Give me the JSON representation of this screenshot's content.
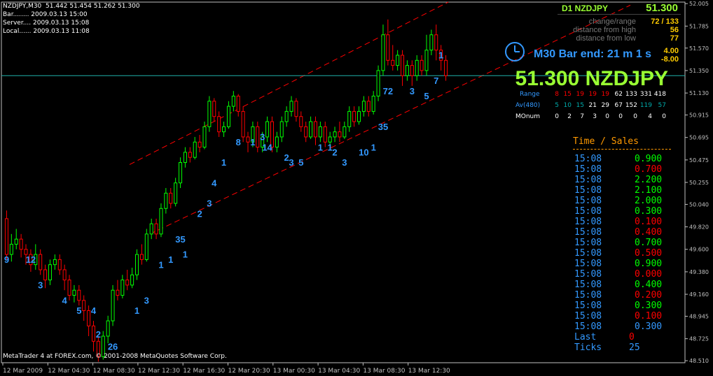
{
  "header": {
    "symbol_line": "NZDJPY,M30  51.442 51.454 51.262 51.300",
    "bar_line": "Bar........ 2009.03.13 15:00",
    "server_line": "Server.... 2009.03.13 15:08",
    "local_line": "Local...... 2009.03.13 11:08"
  },
  "panel": {
    "d1_label": "D1  NZDJPY",
    "d1_price": "51.300",
    "change_range_label": "change/range",
    "change_range_value": "72 / 133",
    "dist_high_label": "distance from high",
    "dist_high_value": "56",
    "dist_low_label": "distance from low",
    "dist_low_value": "77",
    "bar_end_text": "M30 Bar end: 21 m 1 s",
    "bar_end_val1": "4.00",
    "bar_end_val2": "-8.00",
    "big_price": "51.300 NZDJPY",
    "range_label": "Range",
    "range_values": [
      "8",
      "15",
      "19",
      "19",
      "19",
      "62",
      "133",
      "331",
      "418"
    ],
    "av_label": "Av(480)",
    "av_values": [
      "5",
      "10",
      "15",
      "21",
      "29",
      "67",
      "152",
      "119",
      "57"
    ],
    "monum_label": "MOnum",
    "monum_values": [
      "0",
      "2",
      "7",
      "3",
      "0",
      "0",
      "0",
      "4",
      "0"
    ],
    "ts_title": "Time / Sales",
    "ts_rows": [
      {
        "time": "15:08",
        "value": "0.900",
        "color": "#00ff00"
      },
      {
        "time": "15:08",
        "value": "0.700",
        "color": "#ff0000"
      },
      {
        "time": "15:08",
        "value": "2.200",
        "color": "#00ff00"
      },
      {
        "time": "15:08",
        "value": "2.100",
        "color": "#00ff00"
      },
      {
        "time": "15:08",
        "value": "2.000",
        "color": "#00ff00"
      },
      {
        "time": "15:08",
        "value": "0.300",
        "color": "#00ff00"
      },
      {
        "time": "15:08",
        "value": "0.100",
        "color": "#ff0000"
      },
      {
        "time": "15:08",
        "value": "0.400",
        "color": "#ff0000"
      },
      {
        "time": "15:08",
        "value": "0.700",
        "color": "#00ff00"
      },
      {
        "time": "15:08",
        "value": "0.500",
        "color": "#ff0000"
      },
      {
        "time": "15:08",
        "value": "0.900",
        "color": "#00ff00"
      },
      {
        "time": "15:08",
        "value": "0.000",
        "color": "#ff0000"
      },
      {
        "time": "15:08",
        "value": "0.400",
        "color": "#00ff00"
      },
      {
        "time": "15:08",
        "value": "0.200",
        "color": "#ff0000"
      },
      {
        "time": "15:08",
        "value": "0.300",
        "color": "#00ff00"
      },
      {
        "time": "15:08",
        "value": "0.100",
        "color": "#ff0000"
      },
      {
        "time": "15:08",
        "value": "0.300",
        "color": "#3399ff"
      }
    ],
    "last_label": "Last",
    "last_value": "0",
    "ticks_label": "Ticks",
    "ticks_value": "25"
  },
  "copyright": "MetaTrader 4 at FOREX.com, © 2001-2008 MetaQuotes Software Corp.",
  "colors": {
    "bull": "#00ff00",
    "bear": "#ff0000",
    "channel": "#ff0000",
    "price_line": "#20b2aa",
    "counts": "#3399ff",
    "yellow_green": "#99ff33"
  },
  "chart_data": {
    "type": "candlestick",
    "symbol": "NZDJPY",
    "timeframe": "M30",
    "ylim": [
      48.49,
      52.02
    ],
    "y_ticks": [
      "52.005",
      "51.785",
      "51.570",
      "51.350",
      "51.130",
      "50.915",
      "50.695",
      "50.475",
      "50.255",
      "50.040",
      "49.820",
      "49.600",
      "49.380",
      "49.160",
      "48.945",
      "48.725",
      "48.510"
    ],
    "x_ticks": [
      "12 Mar 2009",
      "12 Mar 04:30",
      "12 Mar 08:30",
      "12 Mar 12:30",
      "12 Mar 16:30",
      "12 Mar 20:30",
      "13 Mar 00:30",
      "13 Mar 04:30",
      "13 Mar 08:30",
      "13 Mar 12:30"
    ],
    "current_price": 51.3,
    "candles": [
      [
        49.9,
        49.55,
        49.98,
        49.5
      ],
      [
        49.55,
        49.65,
        49.75,
        49.48
      ],
      [
        49.65,
        49.7,
        49.8,
        49.6
      ],
      [
        49.7,
        49.6,
        49.75,
        49.52
      ],
      [
        49.6,
        49.55,
        49.65,
        49.45
      ],
      [
        49.55,
        49.45,
        49.6,
        49.38
      ],
      [
        49.45,
        49.55,
        49.65,
        49.4
      ],
      [
        49.55,
        49.4,
        49.6,
        49.35
      ],
      [
        49.4,
        49.3,
        49.45,
        49.22
      ],
      [
        49.3,
        49.45,
        49.5,
        49.25
      ],
      [
        49.45,
        49.5,
        49.55,
        49.4
      ],
      [
        49.5,
        49.4,
        49.55,
        49.35
      ],
      [
        49.4,
        49.3,
        49.45,
        49.2
      ],
      [
        49.3,
        49.15,
        49.35,
        49.1
      ],
      [
        49.15,
        49.2,
        49.25,
        49.08
      ],
      [
        49.2,
        49.1,
        49.25,
        49.05
      ],
      [
        49.1,
        49.0,
        49.15,
        48.9
      ],
      [
        49.0,
        48.85,
        49.05,
        48.75
      ],
      [
        48.85,
        48.7,
        48.9,
        48.6
      ],
      [
        48.7,
        48.55,
        48.75,
        48.5
      ],
      [
        48.55,
        48.75,
        48.8,
        48.52
      ],
      [
        48.75,
        48.9,
        48.95,
        48.68
      ],
      [
        48.9,
        49.2,
        49.25,
        48.85
      ],
      [
        49.2,
        49.15,
        49.3,
        49.1
      ],
      [
        49.15,
        49.3,
        49.35,
        49.12
      ],
      [
        49.3,
        49.25,
        49.4,
        49.2
      ],
      [
        49.25,
        49.35,
        49.42,
        49.22
      ],
      [
        49.35,
        49.55,
        49.6,
        49.3
      ],
      [
        49.55,
        49.5,
        49.65,
        49.45
      ],
      [
        49.5,
        49.75,
        49.8,
        49.48
      ],
      [
        49.75,
        49.85,
        49.9,
        49.7
      ],
      [
        49.85,
        49.75,
        49.9,
        49.7
      ],
      [
        49.75,
        50.0,
        50.05,
        49.72
      ],
      [
        50.0,
        50.15,
        50.2,
        49.95
      ],
      [
        50.15,
        50.05,
        50.2,
        50.0
      ],
      [
        50.05,
        50.25,
        50.3,
        50.02
      ],
      [
        50.25,
        50.45,
        50.5,
        50.2
      ],
      [
        50.45,
        50.55,
        50.6,
        50.4
      ],
      [
        50.55,
        50.5,
        50.6,
        50.45
      ],
      [
        50.5,
        50.65,
        50.7,
        50.48
      ],
      [
        50.65,
        50.6,
        50.72,
        50.55
      ],
      [
        50.6,
        50.8,
        50.85,
        50.58
      ],
      [
        50.8,
        51.05,
        51.1,
        50.75
      ],
      [
        51.05,
        50.9,
        51.08,
        50.85
      ],
      [
        50.9,
        50.75,
        50.95,
        50.7
      ],
      [
        50.75,
        50.8,
        50.85,
        50.7
      ],
      [
        50.8,
        51.0,
        51.05,
        50.78
      ],
      [
        51.0,
        51.1,
        51.15,
        50.95
      ],
      [
        51.1,
        50.95,
        51.12,
        50.9
      ],
      [
        50.95,
        50.7,
        51.0,
        50.65
      ],
      [
        50.7,
        50.65,
        50.75,
        50.55
      ],
      [
        50.65,
        50.8,
        50.85,
        50.6
      ],
      [
        50.8,
        50.6,
        50.85,
        50.55
      ],
      [
        50.6,
        50.7,
        50.75,
        50.55
      ],
      [
        50.7,
        50.85,
        50.9,
        50.65
      ],
      [
        50.85,
        50.6,
        50.9,
        50.55
      ],
      [
        50.6,
        50.7,
        50.75,
        50.55
      ],
      [
        50.7,
        50.85,
        50.9,
        50.65
      ],
      [
        50.85,
        50.95,
        51.0,
        50.8
      ],
      [
        50.95,
        51.05,
        51.1,
        50.9
      ],
      [
        51.05,
        50.9,
        51.08,
        50.85
      ],
      [
        50.9,
        50.8,
        50.95,
        50.75
      ],
      [
        50.8,
        50.7,
        50.85,
        50.65
      ],
      [
        50.7,
        50.85,
        50.9,
        50.68
      ],
      [
        50.85,
        50.7,
        50.9,
        50.62
      ],
      [
        50.7,
        50.8,
        50.85,
        50.65
      ],
      [
        50.8,
        50.65,
        50.85,
        50.6
      ],
      [
        50.65,
        50.7,
        50.75,
        50.6
      ],
      [
        50.7,
        50.75,
        50.8,
        50.65
      ],
      [
        50.75,
        50.7,
        50.85,
        50.65
      ],
      [
        50.7,
        50.8,
        50.85,
        50.68
      ],
      [
        50.8,
        50.95,
        51.0,
        50.75
      ],
      [
        50.95,
        50.85,
        51.0,
        50.8
      ],
      [
        50.85,
        50.95,
        51.0,
        50.82
      ],
      [
        50.95,
        51.05,
        51.1,
        50.9
      ],
      [
        51.05,
        50.95,
        51.1,
        50.9
      ],
      [
        50.95,
        51.1,
        51.15,
        50.92
      ],
      [
        51.1,
        51.35,
        51.4,
        51.05
      ],
      [
        51.35,
        51.7,
        51.8,
        51.3
      ],
      [
        51.7,
        51.45,
        51.85,
        51.4
      ],
      [
        51.45,
        51.4,
        51.6,
        51.35
      ],
      [
        51.4,
        51.5,
        51.55,
        51.35
      ],
      [
        51.5,
        51.3,
        51.55,
        51.2
      ],
      [
        51.3,
        51.4,
        51.45,
        51.25
      ],
      [
        51.4,
        51.3,
        51.45,
        51.2
      ],
      [
        51.3,
        51.45,
        51.5,
        51.25
      ],
      [
        51.45,
        51.35,
        51.5,
        51.3
      ],
      [
        51.35,
        51.55,
        51.7,
        51.3
      ],
      [
        51.55,
        51.7,
        51.75,
        51.5
      ],
      [
        51.7,
        51.55,
        51.8,
        51.45
      ],
      [
        51.55,
        51.45,
        51.6,
        51.35
      ],
      [
        51.45,
        51.3,
        51.5,
        51.25
      ]
    ],
    "counts": [
      {
        "text": "9",
        "i": 0,
        "y": 49.55
      },
      {
        "text": "12",
        "i": 5,
        "y": 49.55
      },
      {
        "text": "3",
        "i": 7,
        "y": 49.3
      },
      {
        "text": "4",
        "i": 12,
        "y": 49.15
      },
      {
        "text": "5",
        "i": 15,
        "y": 49.05
      },
      {
        "text": "4",
        "i": 18,
        "y": 49.05
      },
      {
        "text": "2",
        "i": 19,
        "y": 48.82
      },
      {
        "text": "26",
        "i": 22,
        "y": 48.7
      },
      {
        "text": "1",
        "i": 27,
        "y": 49.05
      },
      {
        "text": "3",
        "i": 29,
        "y": 49.15
      },
      {
        "text": "1",
        "i": 32,
        "y": 49.5
      },
      {
        "text": "1",
        "i": 34,
        "y": 49.55
      },
      {
        "text": "35",
        "i": 36,
        "y": 49.75
      },
      {
        "text": "1",
        "i": 37,
        "y": 49.6
      },
      {
        "text": "2",
        "i": 40,
        "y": 50.0
      },
      {
        "text": "3",
        "i": 42,
        "y": 50.1
      },
      {
        "text": "4",
        "i": 43,
        "y": 50.3
      },
      {
        "text": "1",
        "i": 45,
        "y": 50.5
      },
      {
        "text": "8",
        "i": 48,
        "y": 50.7
      },
      {
        "text": "1",
        "i": 51,
        "y": 50.7
      },
      {
        "text": "3",
        "i": 53,
        "y": 50.75
      },
      {
        "text": "14",
        "i": 54,
        "y": 50.65
      },
      {
        "text": "2",
        "i": 58,
        "y": 50.55
      },
      {
        "text": "3",
        "i": 59,
        "y": 50.5
      },
      {
        "text": "5",
        "i": 61,
        "y": 50.5
      },
      {
        "text": "1",
        "i": 65,
        "y": 50.65
      },
      {
        "text": "1",
        "i": 67,
        "y": 50.65
      },
      {
        "text": "2",
        "i": 68,
        "y": 50.6
      },
      {
        "text": "3",
        "i": 70,
        "y": 50.5
      },
      {
        "text": "10",
        "i": 74,
        "y": 50.6
      },
      {
        "text": "1",
        "i": 76,
        "y": 50.65
      },
      {
        "text": "35",
        "i": 78,
        "y": 50.85
      },
      {
        "text": "72",
        "i": 79,
        "y": 51.2
      },
      {
        "text": "3",
        "i": 84,
        "y": 51.2
      },
      {
        "text": "5",
        "i": 87,
        "y": 51.15
      },
      {
        "text": "7",
        "i": 89,
        "y": 51.3
      },
      {
        "text": "1",
        "i": 90,
        "y": 51.55
      }
    ]
  }
}
